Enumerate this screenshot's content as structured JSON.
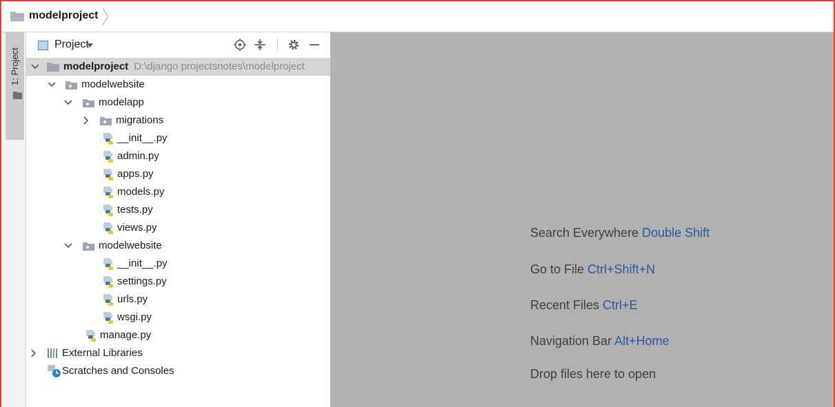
{
  "navbar": {
    "project_name": "modelproject"
  },
  "tool_window_strip": {
    "label": "1: Project"
  },
  "project_panel": {
    "title": "Project",
    "header_icons": [
      "locate-icon",
      "collapse-all-icon",
      "gear-icon",
      "hide-icon"
    ]
  },
  "tree": {
    "root": {
      "name": "modelproject",
      "path": "D:\\django projectsnotes\\modelproject"
    },
    "modelwebsite": "modelwebsite",
    "modelapp": "modelapp",
    "migrations": "migrations",
    "app_files": [
      "__init__.py",
      "admin.py",
      "apps.py",
      "models.py",
      "tests.py",
      "views.py"
    ],
    "inner_package": "modelwebsite",
    "inner_files": [
      "__init__.py",
      "settings.py",
      "urls.py",
      "wsgi.py"
    ],
    "manage": "manage.py",
    "external_libraries": "External Libraries",
    "scratches": "Scratches and Consoles"
  },
  "editor_hints": [
    {
      "label": "Search Everywhere",
      "shortcut": "Double Shift"
    },
    {
      "label": "Go to File",
      "shortcut": "Ctrl+Shift+N"
    },
    {
      "label": "Recent Files",
      "shortcut": "Ctrl+E"
    },
    {
      "label": "Navigation Bar",
      "shortcut": "Alt+Home"
    },
    {
      "label": "Drop files here to open",
      "shortcut": ""
    }
  ],
  "colors": {
    "frame_border": "#e53935",
    "editor_background": "#b1b1b1",
    "shortcut_text": "#2e58a6",
    "selected_row": "#d6d6d6"
  }
}
